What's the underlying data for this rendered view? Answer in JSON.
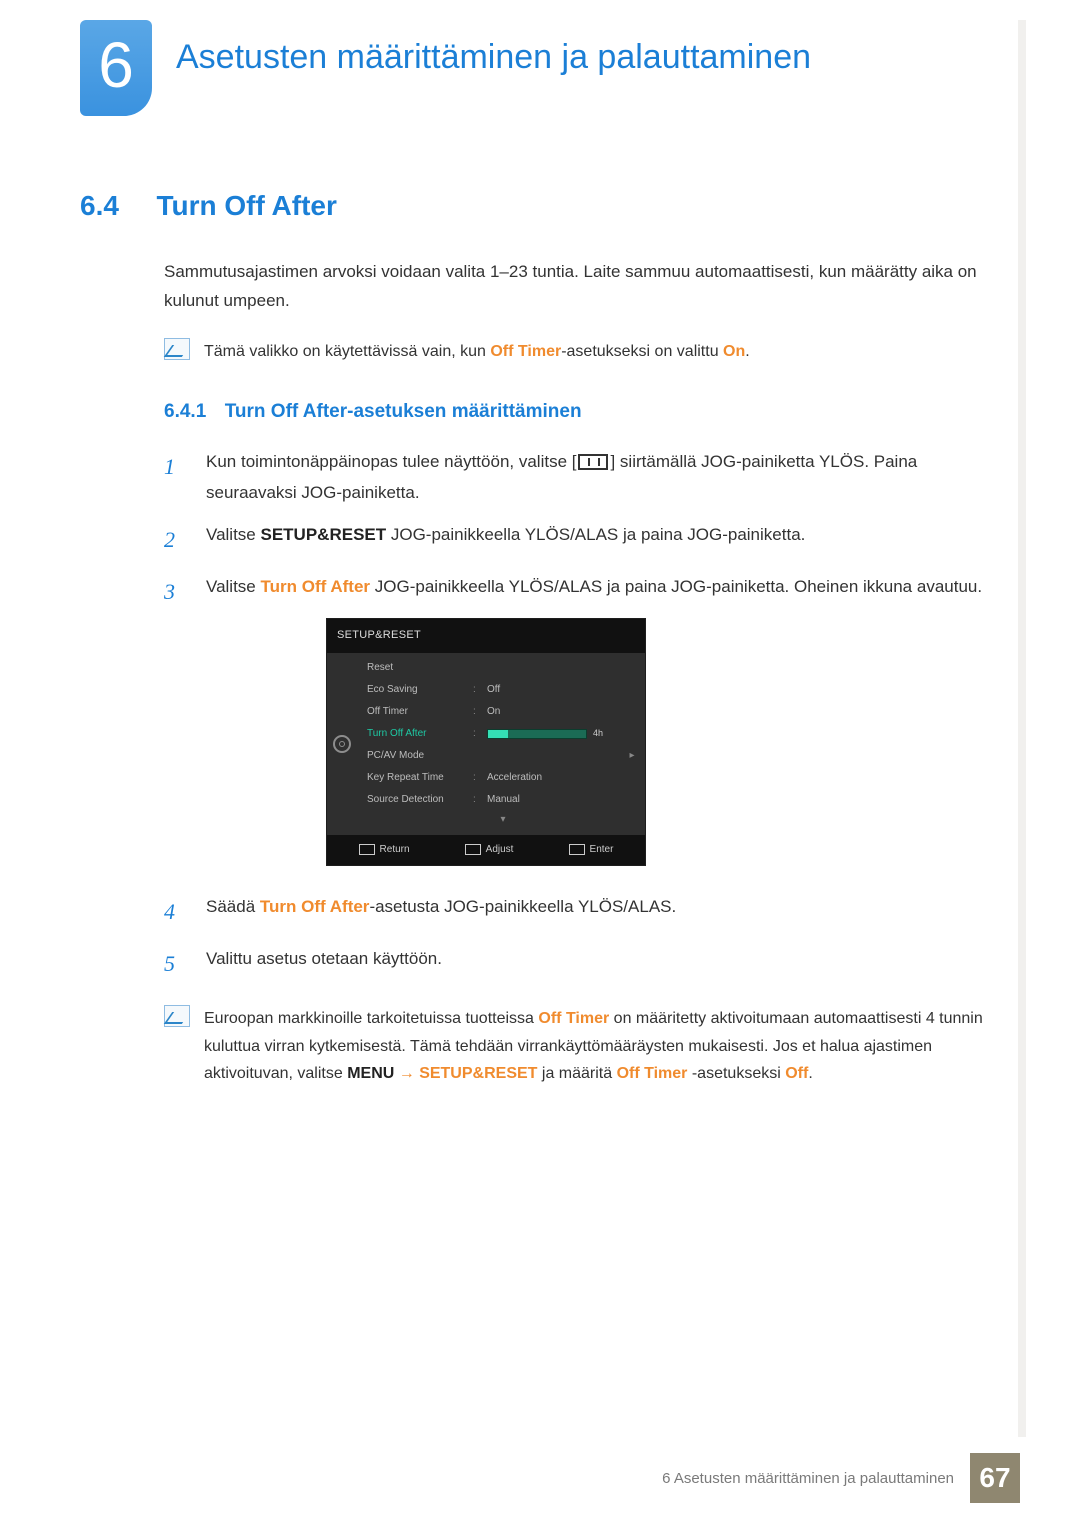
{
  "chapter": {
    "number": "6",
    "title": "Asetusten määrittäminen ja palauttaminen"
  },
  "section": {
    "number": "6.4",
    "title": "Turn Off After",
    "intro": "Sammutusajastimen arvoksi voidaan valita 1–23 tuntia. Laite sammuu automaattisesti, kun määrätty aika on kulunut umpeen."
  },
  "note1": {
    "pre": "Tämä valikko on käytettävissä vain, kun ",
    "accent1": "Off Timer",
    "mid": "-asetukseksi on valittu ",
    "accent2": "On",
    "post": "."
  },
  "subsection": {
    "number": "6.4.1",
    "title": "Turn Off After-asetuksen määrittäminen"
  },
  "steps": {
    "s1a": "Kun toimintonäppäinopas tulee näyttöön, valitse [",
    "s1b": "] siirtämällä JOG-painiketta YLÖS. Paina seuraavaksi JOG-painiketta.",
    "s2a": "Valitse ",
    "s2_strong": "SETUP&RESET",
    "s2b": " JOG-painikkeella YLÖS/ALAS ja paina JOG-painiketta.",
    "s3a": "Valitse ",
    "s3_accent": "Turn Off After",
    "s3b": " JOG-painikkeella YLÖS/ALAS ja paina JOG-painiketta. Oheinen ikkuna avautuu.",
    "s4a": "Säädä ",
    "s4_accent": "Turn Off After",
    "s4b": "-asetusta JOG-painikkeella YLÖS/ALAS.",
    "s5": "Valittu asetus otetaan käyttöön."
  },
  "osd": {
    "header": "SETUP&RESET",
    "rows": [
      {
        "label": "Reset",
        "value": ""
      },
      {
        "label": "Eco Saving",
        "value": "Off"
      },
      {
        "label": "Off Timer",
        "value": "On"
      },
      {
        "label": "Turn Off After",
        "value": "4h",
        "active": true,
        "bar": true
      },
      {
        "label": "PC/AV Mode",
        "value": "",
        "arrow": true
      },
      {
        "label": "Key Repeat Time",
        "value": "Acceleration"
      },
      {
        "label": "Source Detection",
        "value": "Manual"
      }
    ],
    "foot": {
      "return": "Return",
      "adjust": "Adjust",
      "enter": "Enter"
    }
  },
  "note2": {
    "t1": "Euroopan markkinoille tarkoitetuissa tuotteissa ",
    "a1": "Off Timer",
    "t2": " on määritetty aktivoitumaan automaattisesti 4 tunnin kuluttua virran kytkemisestä. Tämä tehdään virrankäyttömääräysten mukaisesti. Jos et halua ajastimen aktivoituvan, valitse ",
    "a2": "MENU",
    "arrow": " → ",
    "a3": "SETUP&RESET",
    "t3": " ja määritä ",
    "a4": "Off Timer",
    "t4": " -asetukseksi ",
    "a5": "Off",
    "t5": "."
  },
  "footer": {
    "text": "6 Asetusten määrittäminen ja palauttaminen",
    "page": "67"
  }
}
